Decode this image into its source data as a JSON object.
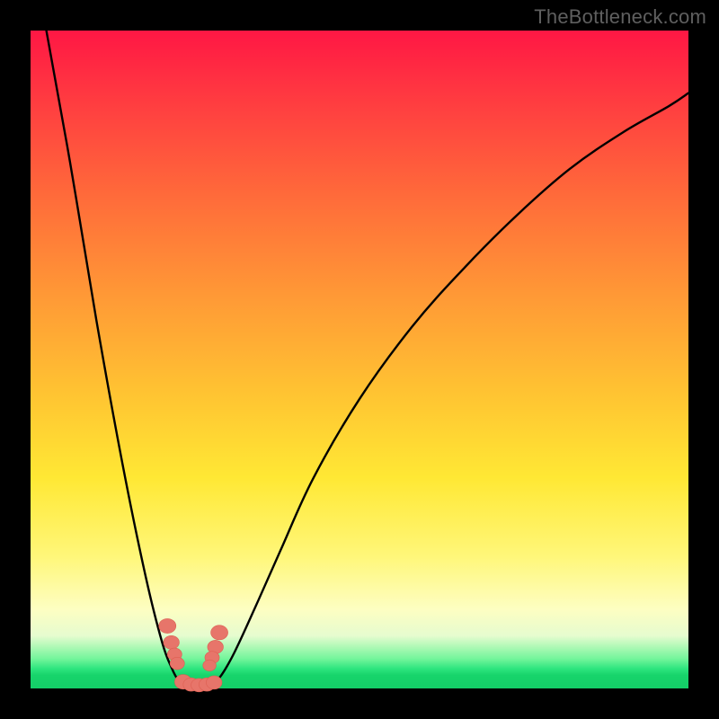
{
  "watermark": "TheBottleneck.com",
  "colors": {
    "background": "#000000",
    "gradient_top": "#ff1744",
    "gradient_bottom": "#14cf68",
    "bead_fill": "#e7756a",
    "curve_stroke": "#000000"
  },
  "chart_data": {
    "type": "line",
    "title": "",
    "xlabel": "",
    "ylabel": "",
    "xlim": [
      0,
      1
    ],
    "ylim": [
      0,
      1
    ],
    "note": "V-shaped curve over vertical rainbow gradient; minimum near x≈0.24 touching bottom green band; right branch rises and exits top-right. Axes not labeled; values are normalized fractions of the plot area.",
    "series": [
      {
        "name": "left-branch",
        "x": [
          0.024,
          0.06,
          0.1,
          0.14,
          0.175,
          0.2,
          0.215,
          0.225,
          0.235
        ],
        "y": [
          1.0,
          0.8,
          0.56,
          0.34,
          0.17,
          0.07,
          0.03,
          0.012,
          0.005
        ]
      },
      {
        "name": "valley-floor",
        "x": [
          0.235,
          0.245,
          0.255,
          0.265,
          0.275
        ],
        "y": [
          0.005,
          0.002,
          0.002,
          0.002,
          0.005
        ]
      },
      {
        "name": "right-branch",
        "x": [
          0.275,
          0.29,
          0.31,
          0.34,
          0.38,
          0.43,
          0.5,
          0.58,
          0.66,
          0.74,
          0.82,
          0.9,
          0.97,
          1.0
        ],
        "y": [
          0.005,
          0.02,
          0.055,
          0.12,
          0.21,
          0.32,
          0.44,
          0.55,
          0.64,
          0.72,
          0.79,
          0.845,
          0.885,
          0.905
        ]
      }
    ],
    "beads": {
      "note": "Salmon-colored marker clusters on the curve near the valley walls and floor (normalized x,y,r).",
      "points": [
        {
          "x": 0.208,
          "y": 0.095,
          "r": 0.013
        },
        {
          "x": 0.214,
          "y": 0.07,
          "r": 0.012
        },
        {
          "x": 0.219,
          "y": 0.052,
          "r": 0.011
        },
        {
          "x": 0.223,
          "y": 0.038,
          "r": 0.011
        },
        {
          "x": 0.287,
          "y": 0.085,
          "r": 0.013
        },
        {
          "x": 0.281,
          "y": 0.063,
          "r": 0.012
        },
        {
          "x": 0.276,
          "y": 0.047,
          "r": 0.011
        },
        {
          "x": 0.272,
          "y": 0.035,
          "r": 0.01
        },
        {
          "x": 0.232,
          "y": 0.01,
          "r": 0.013
        },
        {
          "x": 0.244,
          "y": 0.006,
          "r": 0.012
        },
        {
          "x": 0.256,
          "y": 0.005,
          "r": 0.012
        },
        {
          "x": 0.268,
          "y": 0.006,
          "r": 0.012
        },
        {
          "x": 0.279,
          "y": 0.009,
          "r": 0.012
        }
      ]
    }
  }
}
